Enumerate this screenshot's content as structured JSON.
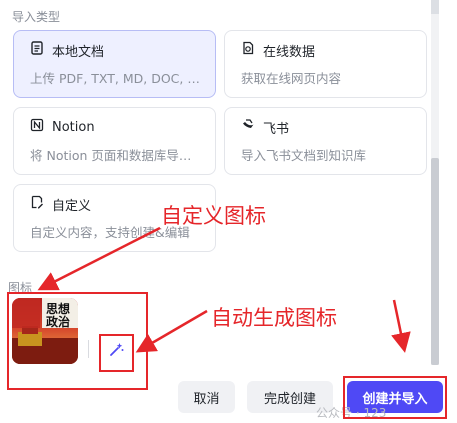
{
  "sections": {
    "import_type_label": "导入类型",
    "icon_label": "图标"
  },
  "cards": [
    {
      "title": "本地文档",
      "desc": "上传 PDF, TXT, MD, DOC, …",
      "icon": "document-icon",
      "selected": true
    },
    {
      "title": "在线数据",
      "desc": "获取在线网页内容",
      "icon": "web-page-icon",
      "selected": false
    },
    {
      "title": "Notion",
      "desc": "将 Notion 页面和数据库导…",
      "icon": "notion-icon",
      "selected": false
    },
    {
      "title": "飞书",
      "desc": "导入飞书文档到知识库",
      "icon": "feishu-icon",
      "selected": false
    },
    {
      "title": "自定义",
      "desc": "自定义内容，支持创建&编辑",
      "icon": "custom-edit-icon",
      "selected": false
    }
  ],
  "icon_thumb": {
    "text_line1": "思想",
    "text_line2": "政治"
  },
  "buttons": {
    "cancel": "取消",
    "done": "完成创建",
    "create_import": "创建并导入"
  },
  "annotations": {
    "custom_icon": "自定义图标",
    "auto_icon": "自动生成图标"
  },
  "watermark": "公众号 · 123",
  "colors": {
    "accent": "#4f49f5",
    "selected_bg": "#eef0ff",
    "annotation_red": "#e5262a"
  }
}
